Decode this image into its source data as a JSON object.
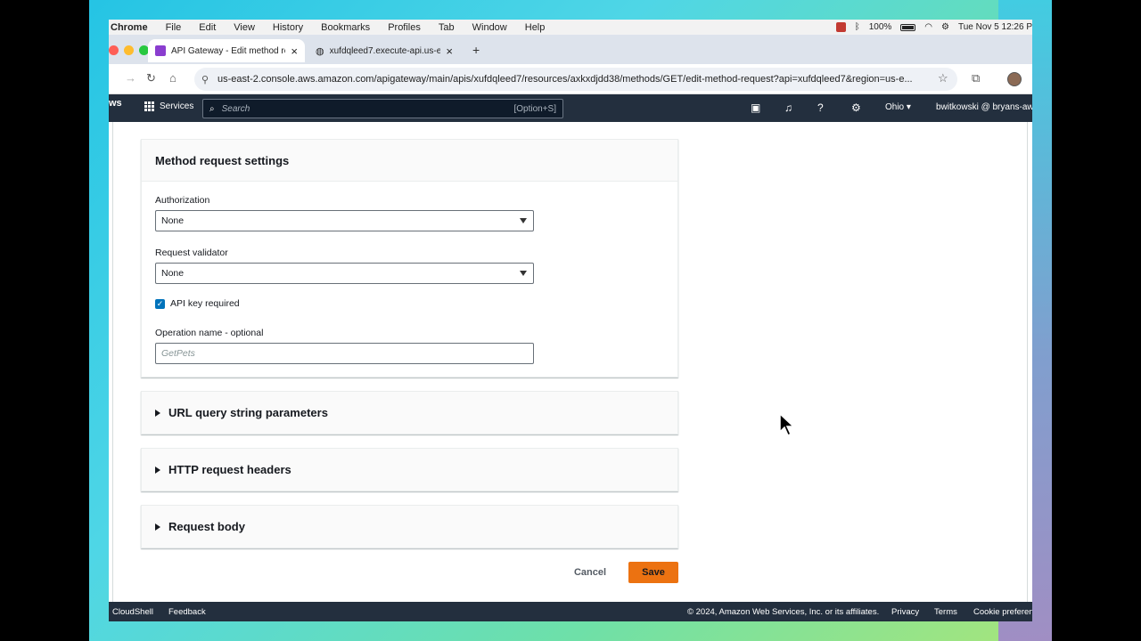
{
  "menubar": {
    "items": [
      "Chrome",
      "File",
      "Edit",
      "View",
      "History",
      "Bookmarks",
      "Profiles",
      "Tab",
      "Window",
      "Help"
    ],
    "battery": "100%",
    "datetime": "Tue Nov 5  12:26 P"
  },
  "tabs": [
    {
      "title": "API Gateway - Edit method re",
      "close": "×"
    },
    {
      "title": "xufdqleed7.execute-api.us-e",
      "close": "×"
    }
  ],
  "newtab": "+",
  "address": {
    "url": "us-east-2.console.aws.amazon.com/apigateway/main/apis/xufdqleed7/resources/axkxdjdd38/methods/GET/edit-method-request?api=xufdqleed7&region=us-e..."
  },
  "aws": {
    "logo": "ws",
    "services": "Services",
    "search_placeholder": "Search",
    "search_shortcut": "[Option+S]",
    "region": "Ohio ▾",
    "user": "bwitkowski @ bryans-aws"
  },
  "settings_panel": {
    "title": "Method request settings",
    "authorization_label": "Authorization",
    "authorization_value": "None",
    "validator_label": "Request validator",
    "validator_value": "None",
    "api_key_label": "API key required",
    "api_key_checked": true,
    "operation_label": "Operation name - optional",
    "operation_placeholder": "GetPets"
  },
  "sections": [
    {
      "label": "URL query string parameters"
    },
    {
      "label": "HTTP request headers"
    },
    {
      "label": "Request body"
    }
  ],
  "actions": {
    "cancel": "Cancel",
    "save": "Save"
  },
  "footer": {
    "cloudshell": "CloudShell",
    "feedback": "Feedback",
    "copyright": "© 2024, Amazon Web Services, Inc. or its affiliates.",
    "privacy": "Privacy",
    "terms": "Terms",
    "cookie": "Cookie preferen"
  },
  "colors": {
    "aws_nav": "#232f3e",
    "save_button": "#ec7211",
    "checkbox": "#0073bb"
  }
}
